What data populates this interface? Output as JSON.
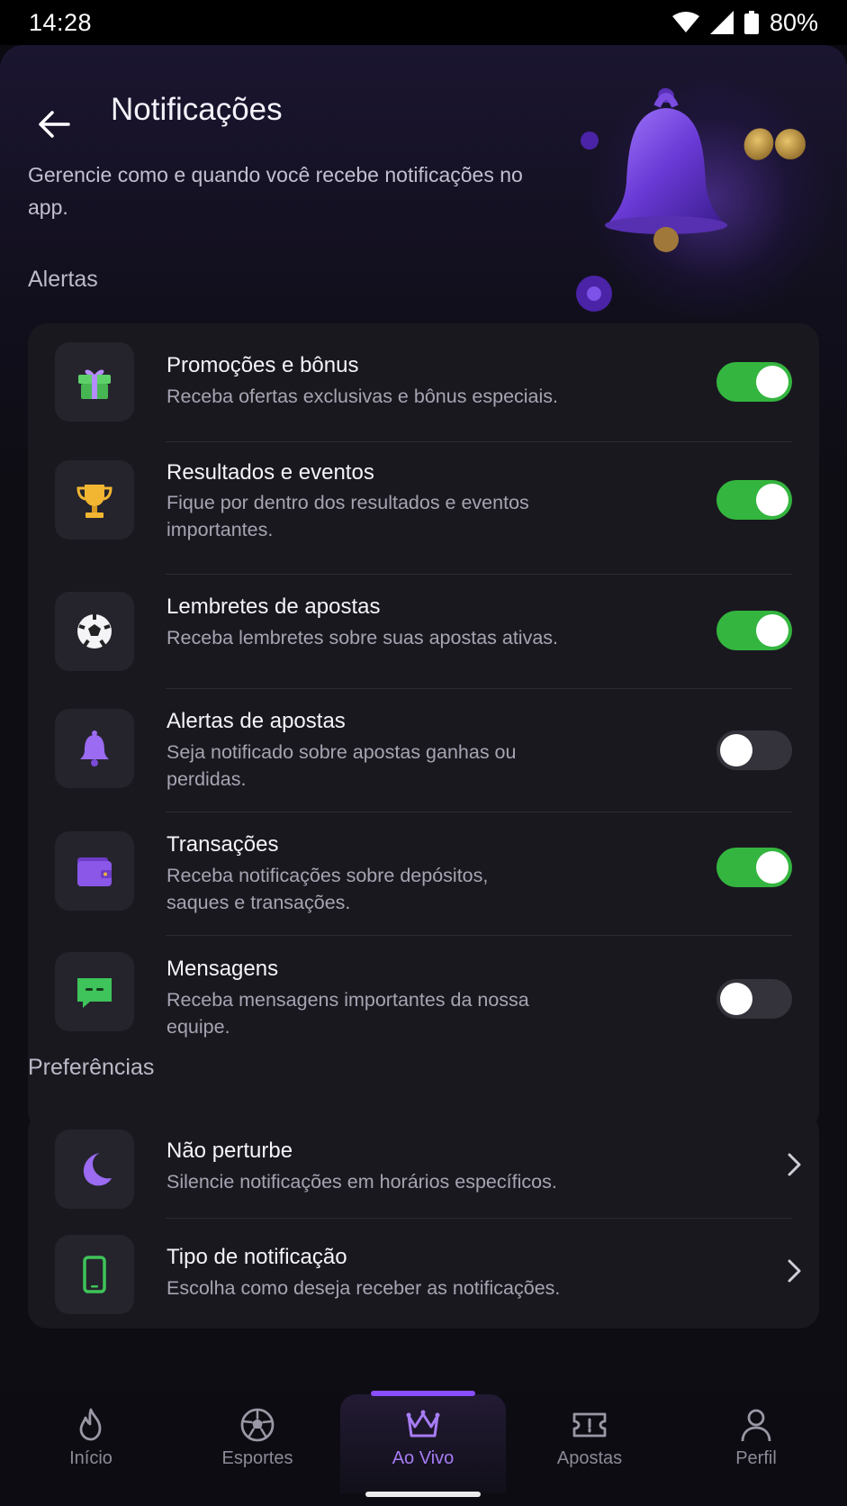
{
  "status_bar": {
    "time": "14:28",
    "battery": "80%"
  },
  "header": {
    "title": "Notificações",
    "description": "Gerencie como e quando você recebe notificações no app."
  },
  "alerts": {
    "section_label": "Alertas",
    "items": [
      {
        "title": "Promoções e bônus",
        "subtitle": "Receba ofertas exclusivas e bônus especiais.",
        "icon": "gift-icon",
        "enabled": true
      },
      {
        "title": "Resultados e eventos",
        "subtitle": "Fique por dentro dos resultados e eventos importantes.",
        "icon": "trophy-icon",
        "enabled": true
      },
      {
        "title": "Lembretes de apostas",
        "subtitle": "Receba lembretes sobre suas apostas ativas.",
        "icon": "soccer-ball-icon",
        "enabled": true
      },
      {
        "title": "Alertas de apostas",
        "subtitle": "Seja notificado sobre apostas ganhas ou perdidas.",
        "icon": "bell-icon",
        "enabled": false
      },
      {
        "title": "Transações",
        "subtitle": "Receba notificações sobre depósitos, saques e transações.",
        "icon": "wallet-icon",
        "enabled": true
      },
      {
        "title": "Mensagens",
        "subtitle": "Receba mensagens importantes da nossa equipe.",
        "icon": "message-icon",
        "enabled": false
      }
    ]
  },
  "preferences": {
    "section_label": "Preferências",
    "items": [
      {
        "title": "Não perturbe",
        "subtitle": "Silencie notificações em horários específicos.",
        "icon": "moon-icon"
      },
      {
        "title": "Tipo de notificação",
        "subtitle": "Escolha como deseja receber as notificações.",
        "icon": "phone-icon"
      }
    ]
  },
  "bottom_nav": {
    "items": [
      {
        "label": "Início",
        "icon": "flame-icon"
      },
      {
        "label": "Esportes",
        "icon": "soccer-ball-icon"
      },
      {
        "label": "Ao Vivo",
        "icon": "crown-icon",
        "active": true
      },
      {
        "label": "Apostas",
        "icon": "ticket-icon"
      },
      {
        "label": "Perfil",
        "icon": "user-icon"
      }
    ]
  },
  "colors": {
    "accent": "#8a4dff",
    "toggle_on": "#34b53f",
    "toggle_off": "#34333c",
    "card": "#19181f"
  }
}
